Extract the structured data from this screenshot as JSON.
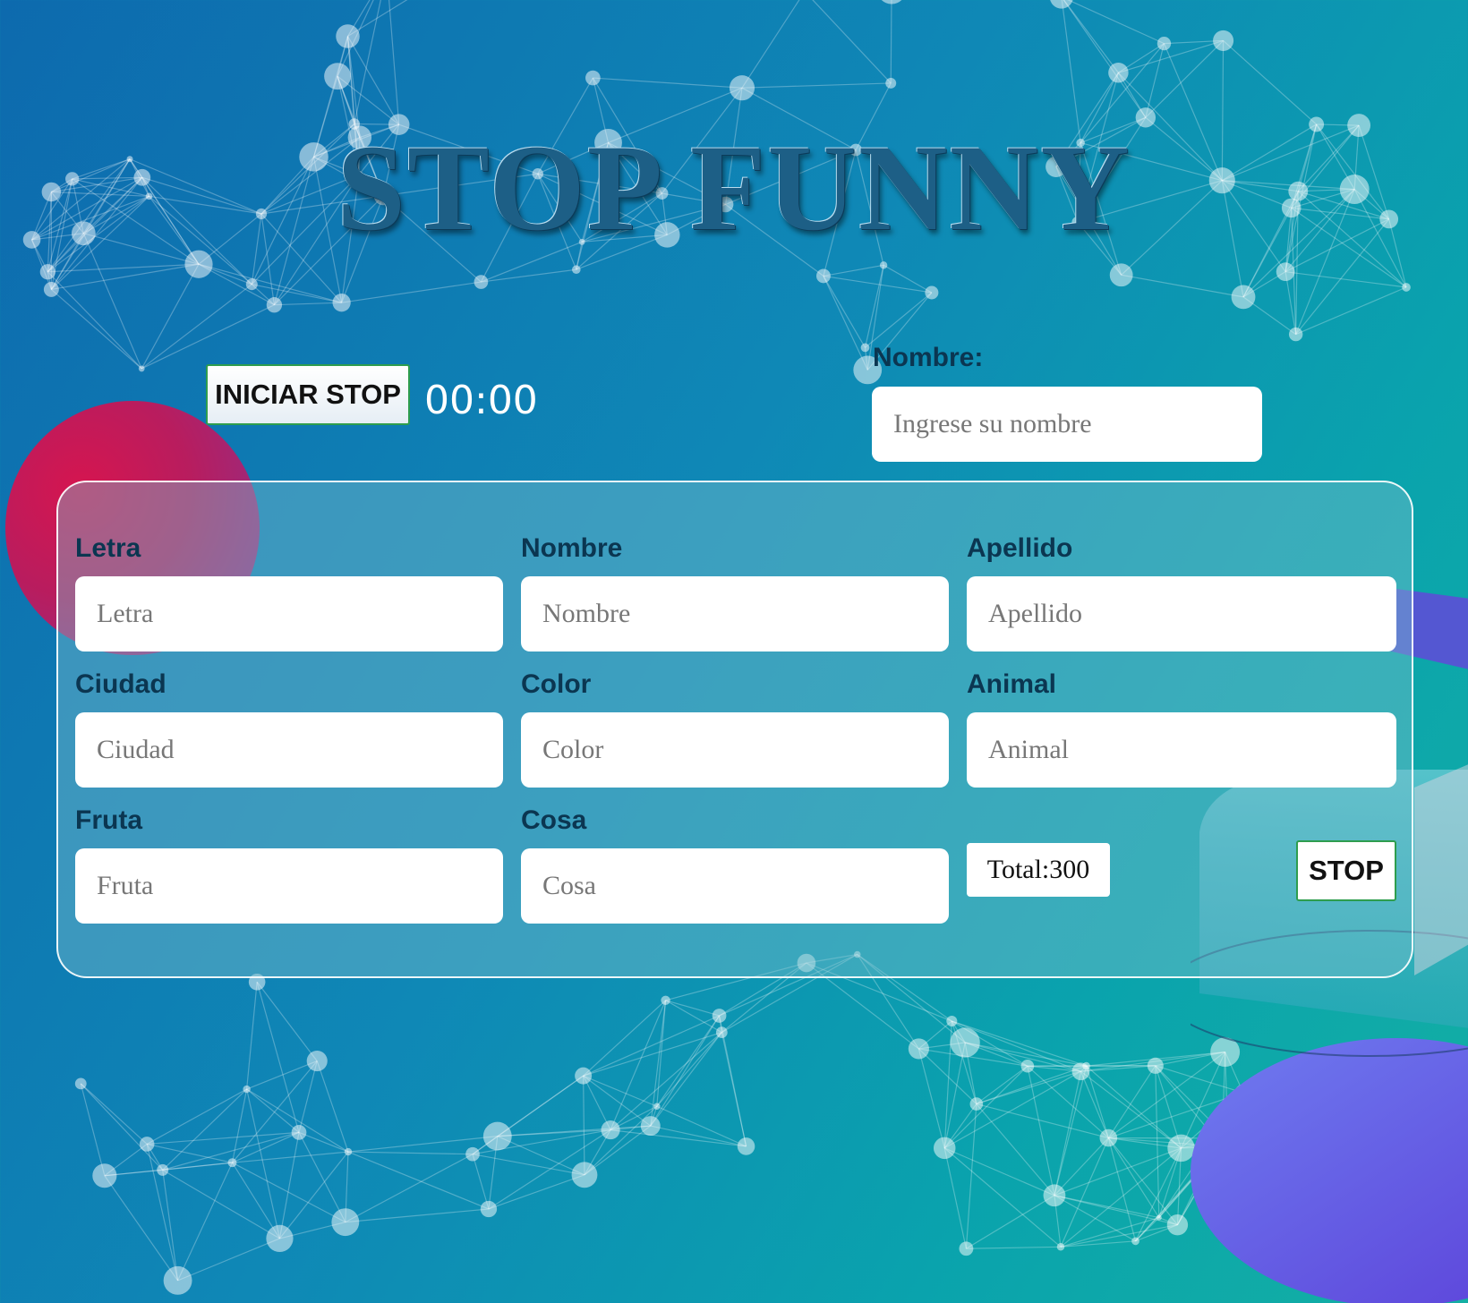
{
  "header": {
    "title": "STOP FUNNY"
  },
  "controls": {
    "start_label": "INICIAR STOP",
    "timer": "00:00"
  },
  "player": {
    "label": "Nombre:",
    "placeholder": "Ingrese su nombre"
  },
  "form": {
    "fields": [
      {
        "label": "Letra",
        "placeholder": "Letra"
      },
      {
        "label": "Nombre",
        "placeholder": "Nombre"
      },
      {
        "label": "Apellido",
        "placeholder": "Apellido"
      },
      {
        "label": "Ciudad",
        "placeholder": "Ciudad"
      },
      {
        "label": "Color",
        "placeholder": "Color"
      },
      {
        "label": "Animal",
        "placeholder": "Animal"
      },
      {
        "label": "Fruta",
        "placeholder": "Fruta"
      },
      {
        "label": "Cosa",
        "placeholder": "Cosa"
      }
    ],
    "total": "Total:300",
    "stop_label": "STOP"
  },
  "colors": {
    "accent_border": "#2e9d4e",
    "label_text": "#0b3651",
    "background_start": "#0d6aae",
    "background_end": "#14b0a3"
  }
}
